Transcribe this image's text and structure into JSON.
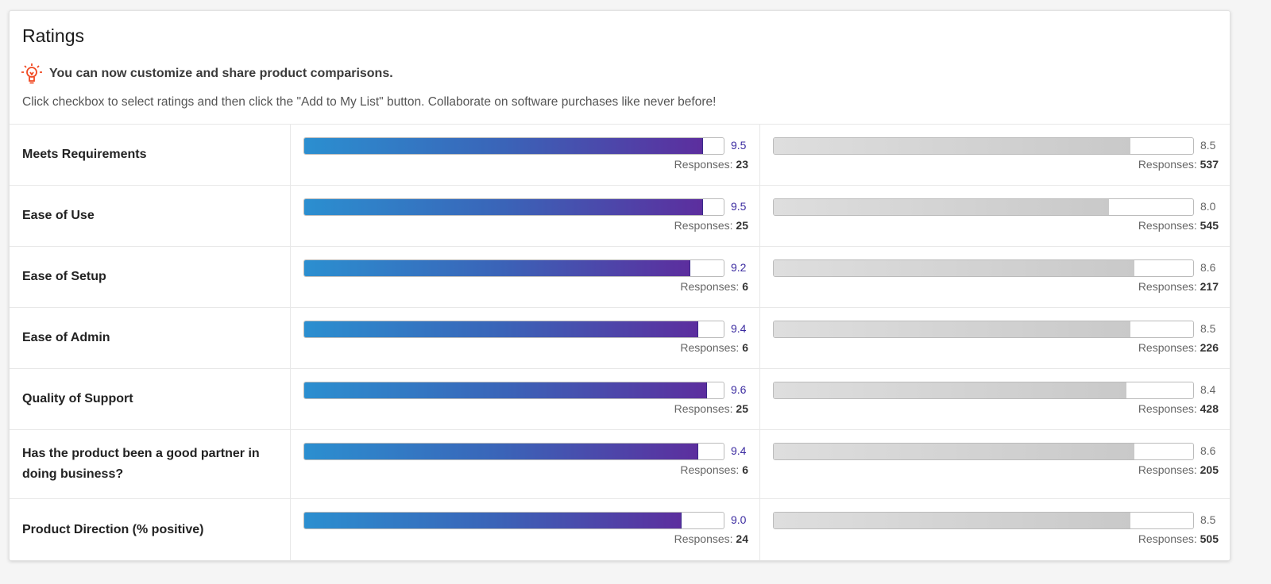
{
  "title": "Ratings",
  "tip": {
    "icon": "lightbulb-icon",
    "text": "You can now customize and share product comparisons."
  },
  "description": "Click checkbox to select ratings and then click the \"Add to My List\" button. Collaborate on software purchases like never before!",
  "responses_label": "Responses:",
  "colors": {
    "accent_start": "#2b8fd0",
    "accent_end": "#5c2e9e",
    "tip_icon": "#f04a23"
  },
  "scale_max": 10,
  "rows": [
    {
      "label": "Meets Requirements",
      "a": {
        "value": "9.5",
        "responses": "23"
      },
      "b": {
        "value": "8.5",
        "responses": "537"
      }
    },
    {
      "label": "Ease of Use",
      "a": {
        "value": "9.5",
        "responses": "25"
      },
      "b": {
        "value": "8.0",
        "responses": "545"
      }
    },
    {
      "label": "Ease of Setup",
      "a": {
        "value": "9.2",
        "responses": "6"
      },
      "b": {
        "value": "8.6",
        "responses": "217"
      }
    },
    {
      "label": "Ease of Admin",
      "a": {
        "value": "9.4",
        "responses": "6"
      },
      "b": {
        "value": "8.5",
        "responses": "226"
      }
    },
    {
      "label": "Quality of Support",
      "a": {
        "value": "9.6",
        "responses": "25"
      },
      "b": {
        "value": "8.4",
        "responses": "428"
      }
    },
    {
      "label": "Has the product been a good partner in doing business?",
      "a": {
        "value": "9.4",
        "responses": "6"
      },
      "b": {
        "value": "8.6",
        "responses": "205"
      }
    },
    {
      "label": "Product Direction (% positive)",
      "a": {
        "value": "9.0",
        "responses": "24"
      },
      "b": {
        "value": "8.5",
        "responses": "505"
      }
    }
  ]
}
